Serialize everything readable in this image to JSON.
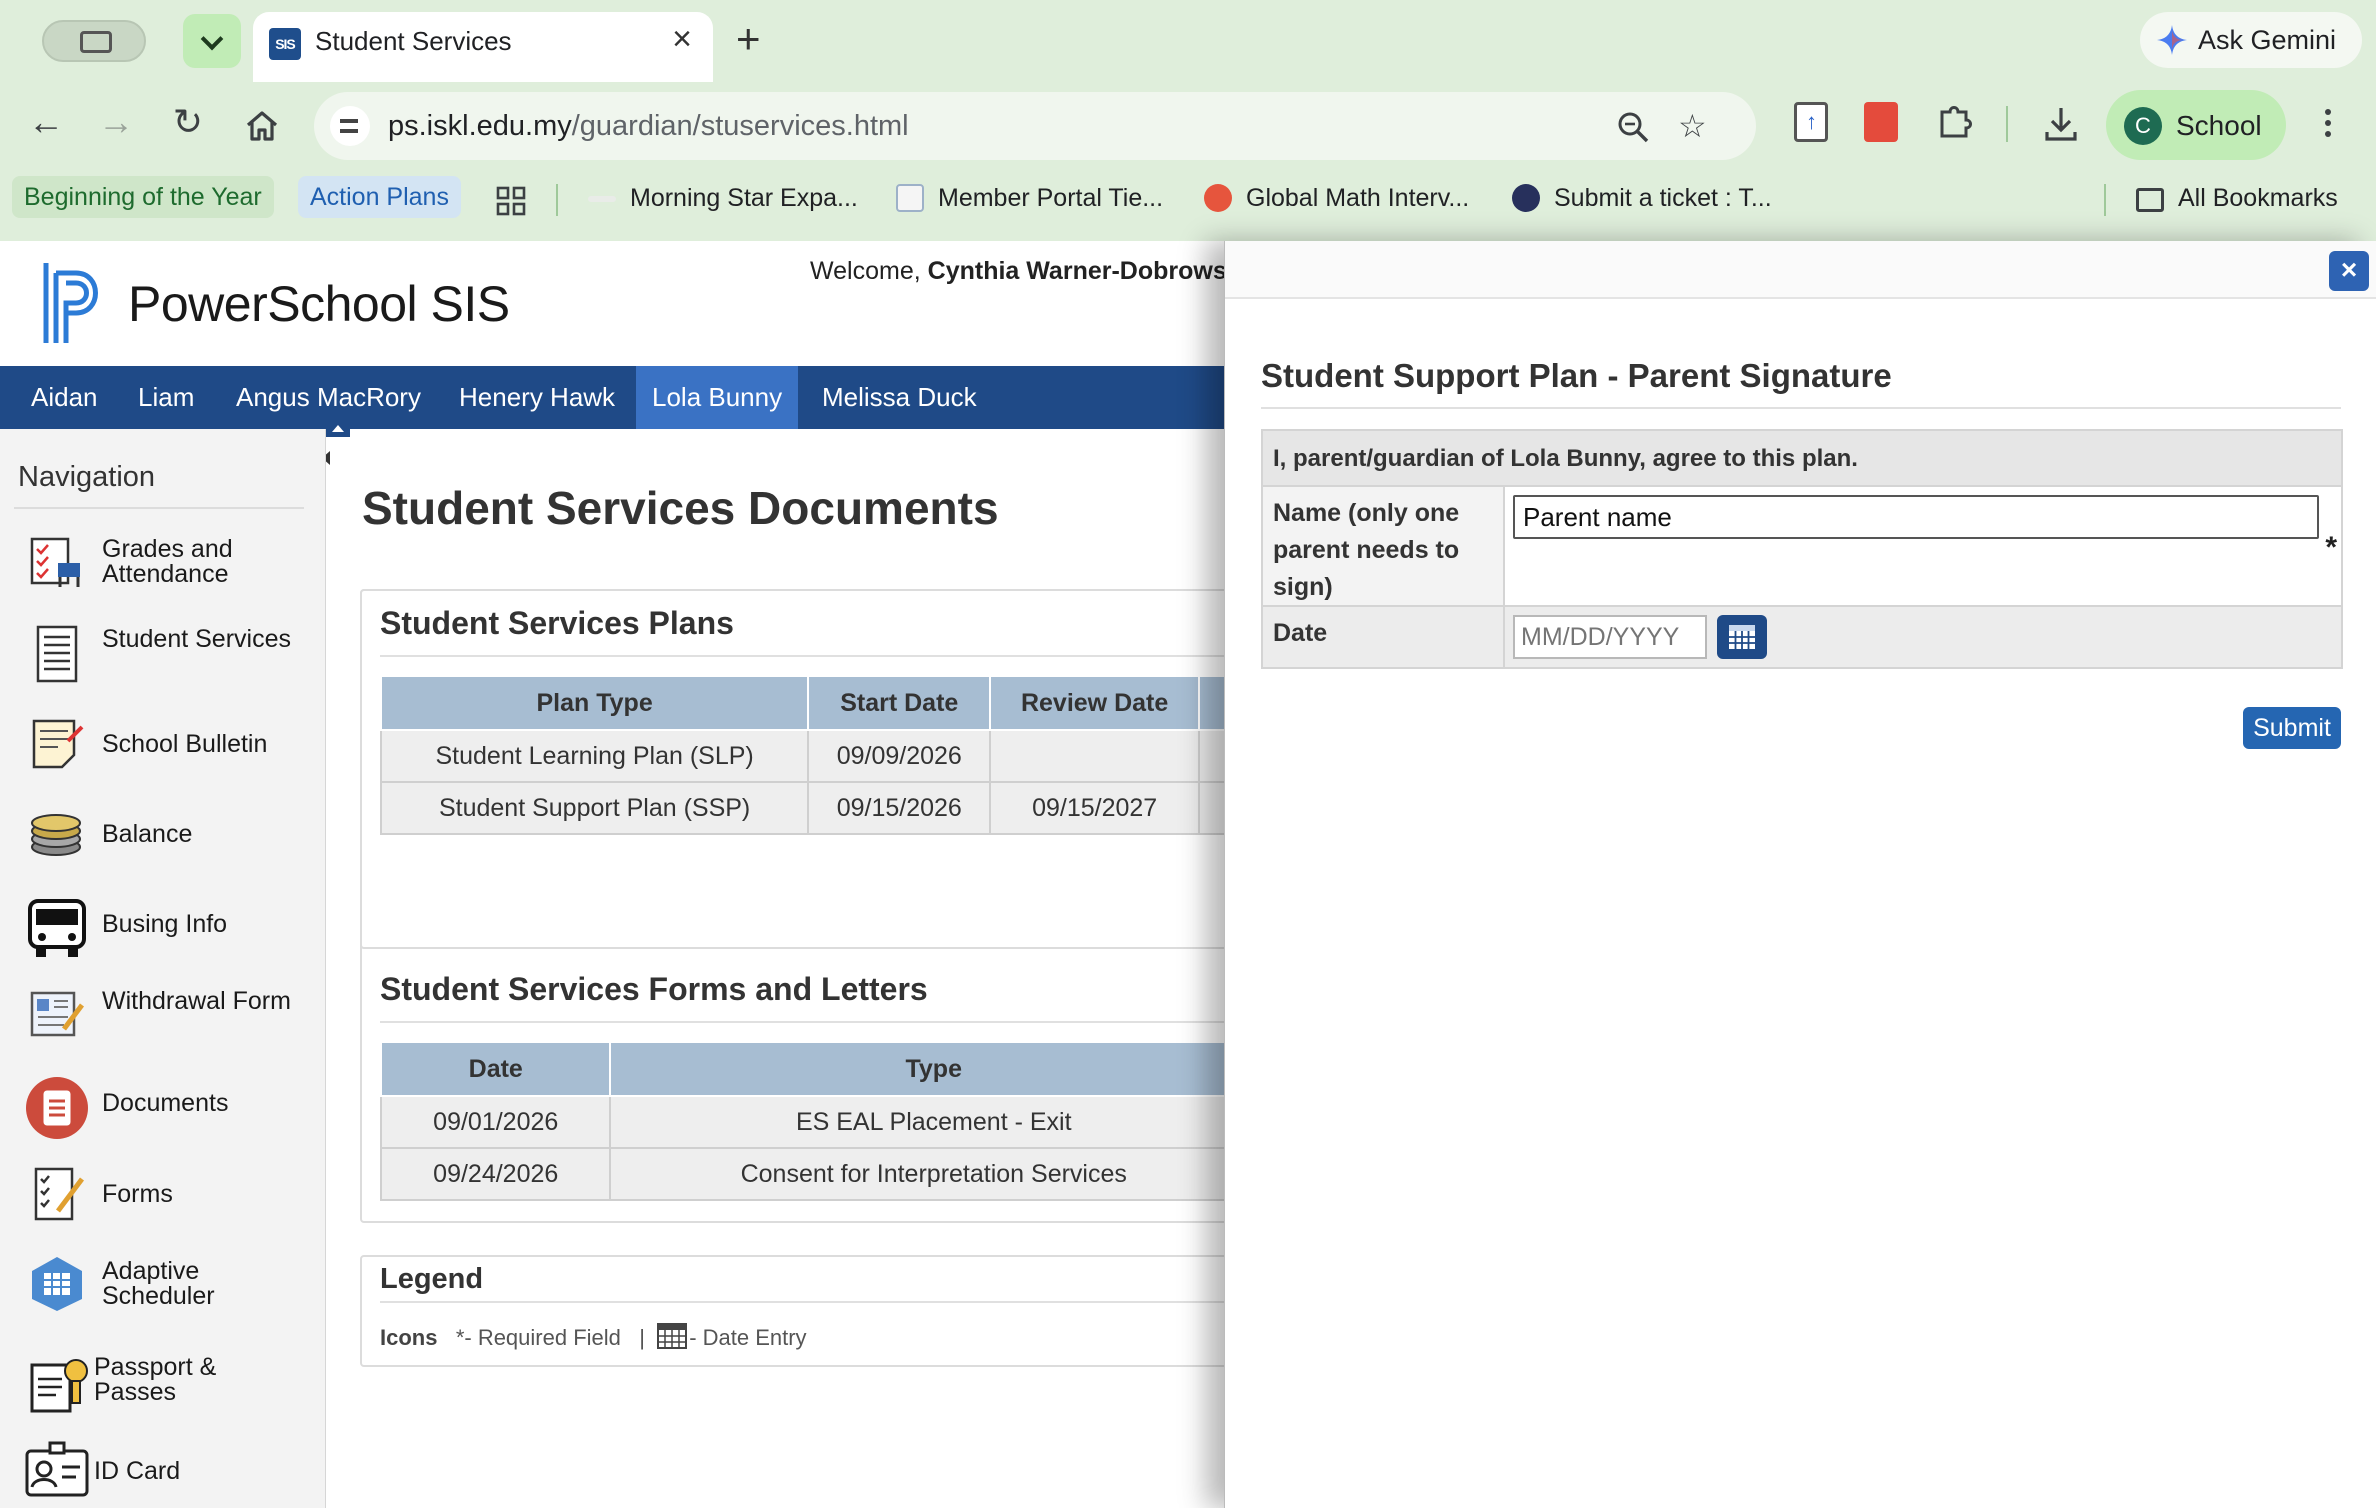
{
  "browser": {
    "tab": {
      "favicon_text": "SIS",
      "title": "Student Services"
    },
    "new_tab": "+",
    "ask_gemini": "Ask Gemini",
    "url_host": "ps.iskl.edu.my",
    "url_path": "/guardian/stuservices.html",
    "profile": {
      "initial": "C",
      "label": "School"
    },
    "bookmarks": [
      {
        "label": "Beginning of the Year"
      },
      {
        "label": "Action Plans"
      },
      {
        "label": "Morning Star Expa..."
      },
      {
        "label": "Member Portal Tie..."
      },
      {
        "label": "Global Math Interv..."
      },
      {
        "label": "Submit a ticket : T..."
      }
    ],
    "all_bookmarks": "All Bookmarks",
    "colors": {
      "chrome": "#dfeedb",
      "accent_green": "#c1ecb6"
    }
  },
  "site": {
    "brand": "PowerSchool SIS",
    "welcome_prefix": "Welcome, ",
    "welcome_name": "Cynthia Warner-Dobrows",
    "students": [
      "Aidan",
      "Liam",
      "Angus MacRory",
      "Henery Hawk",
      "Lola Bunny",
      "Melissa Duck"
    ],
    "selected_student": "Lola Bunny",
    "colors": {
      "primary": "#1f4a87",
      "selected_tab": "#3a72c4",
      "table_header": "#a7bdd2"
    }
  },
  "sidebar": {
    "title": "Navigation",
    "items": [
      {
        "label": "Grades and Attendance",
        "icon": "grades-attendance-icon"
      },
      {
        "label": "Student Services",
        "icon": "student-services-icon"
      },
      {
        "label": "School Bulletin",
        "icon": "school-bulletin-icon"
      },
      {
        "label": "Balance",
        "icon": "balance-icon"
      },
      {
        "label": "Busing Info",
        "icon": "bus-icon"
      },
      {
        "label": "Withdrawal Form",
        "icon": "withdrawal-form-icon"
      },
      {
        "label": "Documents",
        "icon": "documents-icon"
      },
      {
        "label": "Forms",
        "icon": "forms-icon"
      },
      {
        "label": "Adaptive Scheduler",
        "icon": "adaptive-scheduler-icon"
      },
      {
        "label": "Passport & Passes",
        "icon": "passport-icon"
      },
      {
        "label": "ID Card",
        "icon": "id-card-icon"
      }
    ]
  },
  "main": {
    "heading": "Student Services Documents",
    "plans": {
      "title": "Student Services Plans",
      "headers": [
        "Plan Type",
        "Start Date",
        "Review Date"
      ],
      "rows": [
        [
          "Student Learning Plan (SLP)",
          "09/09/2026",
          ""
        ],
        [
          "Student Support Plan (SSP)",
          "09/15/2026",
          "09/15/2027"
        ]
      ]
    },
    "forms": {
      "title": "Student Services Forms and Letters",
      "headers": [
        "Date",
        "Type"
      ],
      "rows": [
        [
          "09/01/2026",
          "ES EAL Placement - Exit"
        ],
        [
          "09/24/2026",
          "Consent for Interpretation Services"
        ]
      ]
    },
    "legend": {
      "title": "Legend",
      "icons_label": "Icons",
      "required": "*- Required Field",
      "separator": "|",
      "date_entry": "- Date Entry"
    }
  },
  "dialog": {
    "close": "×",
    "title": "Student Support Plan - Parent Signature",
    "agree_text": "I, parent/guardian of Lola Bunny, agree to this plan.",
    "name_label": "Name (only one parent needs to sign)",
    "name_value": "Parent name",
    "required_marker": "*",
    "date_label": "Date",
    "date_placeholder": "MM/DD/YYYY",
    "submit": "Submit"
  }
}
